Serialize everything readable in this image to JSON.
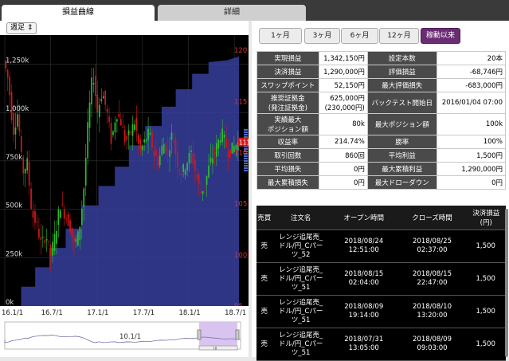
{
  "tabs": [
    "損益曲線",
    "詳細"
  ],
  "period_select": "週足",
  "periods": [
    "1ヶ月",
    "3ヶ月",
    "6ヶ月",
    "12ヶ月",
    "稼動以来"
  ],
  "stats": [
    [
      "実現損益",
      "1,342,150円",
      "g",
      "設定本数",
      "20本",
      ""
    ],
    [
      "決済損益",
      "1,290,000円",
      "g",
      "評価損益",
      "-68,746円",
      "r"
    ],
    [
      "スワップポイント",
      "52,150円",
      "g",
      "最大評価損失",
      "-683,000円",
      "r"
    ],
    [
      "推奨証拠金\n(発注証拠金)",
      "625,000円\n(230,000円)",
      "",
      "バックテスト開始日",
      "2016/01/04 07:00",
      ""
    ],
    [
      "実績最大\nポジション額",
      "80k",
      "",
      "最大ポジション額",
      "100k",
      ""
    ],
    [
      "収益率",
      "214.74%",
      "g",
      "勝率",
      "100%",
      ""
    ],
    [
      "取引回数",
      "860回",
      "",
      "平均利益",
      "1,500円",
      "g"
    ],
    [
      "平均損失",
      "0円",
      "",
      "最大累積利益",
      "1,290,000円",
      "g"
    ],
    [
      "最大累積損失",
      "0円",
      "",
      "最大ドローダウン",
      "0円",
      ""
    ]
  ],
  "trade_headers": [
    "売買",
    "注文名",
    "オープン時間",
    "クローズ時間",
    "決済損益\n(円)"
  ],
  "trades": [
    [
      "売",
      "レンジ追尾売_\nドル/円_Cパー\nツ_52",
      "2018/08/24\n12:51:00",
      "2018/08/25\n02:37:00",
      "1,500"
    ],
    [
      "売",
      "レンジ追尾売_\nドル/円_Cパー\nツ_51",
      "2018/08/15\n02:04:00",
      "2018/08/15\n22:47:00",
      "1,500"
    ],
    [
      "売",
      "レンジ追尾売_\nドル/円_Cパー\nツ_51",
      "2018/08/09\n19:14:00",
      "2018/08/10\n13:20:00",
      "1,500"
    ],
    [
      "売",
      "レンジ追尾売_\nドル/円_Cパー\nツ_51",
      "2018/07/31\n13:05:00",
      "2018/08/09\n09:03:00",
      "1,500"
    ]
  ],
  "chart_data": {
    "type": "area",
    "x_ticks": [
      "16.1/1",
      "16.7/1",
      "17.1/1",
      "17.7/1",
      "18.1/1",
      "18.7/1"
    ],
    "y_left_ticks": [
      "0k",
      "250k",
      "500k",
      "750k",
      "1,000k",
      "1,250k"
    ],
    "y_left_lim": [
      0,
      1400000
    ],
    "y_right_ticks": [
      "95",
      "100",
      "105",
      "110",
      "115",
      "120"
    ],
    "y_right_lim": [
      95,
      121.5
    ],
    "profit_curve": [
      [
        0,
        0
      ],
      [
        0.07,
        0
      ],
      [
        0.07,
        100000
      ],
      [
        0.13,
        100000
      ],
      [
        0.13,
        200000
      ],
      [
        0.19,
        200000
      ],
      [
        0.19,
        300000
      ],
      [
        0.26,
        300000
      ],
      [
        0.26,
        400000
      ],
      [
        0.33,
        400000
      ],
      [
        0.33,
        520000
      ],
      [
        0.4,
        520000
      ],
      [
        0.4,
        620000
      ],
      [
        0.47,
        620000
      ],
      [
        0.47,
        720000
      ],
      [
        0.53,
        720000
      ],
      [
        0.53,
        830000
      ],
      [
        0.6,
        830000
      ],
      [
        0.6,
        930000
      ],
      [
        0.67,
        930000
      ],
      [
        0.67,
        1030000
      ],
      [
        0.73,
        1030000
      ],
      [
        0.73,
        1120000
      ],
      [
        0.8,
        1120000
      ],
      [
        0.8,
        1200000
      ],
      [
        0.87,
        1200000
      ],
      [
        0.87,
        1260000
      ],
      [
        0.95,
        1270000
      ],
      [
        1,
        1290000
      ]
    ],
    "price_path": [
      [
        0,
        119
      ],
      [
        0.02,
        117
      ],
      [
        0.04,
        112
      ],
      [
        0.06,
        114
      ],
      [
        0.08,
        108
      ],
      [
        0.1,
        109
      ],
      [
        0.12,
        104
      ],
      [
        0.14,
        103
      ],
      [
        0.16,
        101
      ],
      [
        0.18,
        102
      ],
      [
        0.2,
        100
      ],
      [
        0.22,
        102
      ],
      [
        0.24,
        105
      ],
      [
        0.26,
        104
      ],
      [
        0.28,
        103
      ],
      [
        0.3,
        101
      ],
      [
        0.32,
        102
      ],
      [
        0.34,
        106
      ],
      [
        0.36,
        113
      ],
      [
        0.38,
        118
      ],
      [
        0.4,
        114
      ],
      [
        0.42,
        116
      ],
      [
        0.44,
        114
      ],
      [
        0.46,
        111
      ],
      [
        0.48,
        114
      ],
      [
        0.5,
        113
      ],
      [
        0.52,
        111
      ],
      [
        0.54,
        112
      ],
      [
        0.56,
        113
      ],
      [
        0.58,
        110
      ],
      [
        0.6,
        111
      ],
      [
        0.62,
        112
      ],
      [
        0.64,
        110
      ],
      [
        0.66,
        109
      ],
      [
        0.68,
        111
      ],
      [
        0.7,
        110
      ],
      [
        0.72,
        112
      ],
      [
        0.74,
        109
      ],
      [
        0.76,
        108
      ],
      [
        0.8,
        110
      ],
      [
        0.82,
        108
      ],
      [
        0.84,
        106
      ],
      [
        0.86,
        107
      ],
      [
        0.88,
        109
      ],
      [
        0.9,
        110
      ],
      [
        0.93,
        112
      ],
      [
        0.96,
        110
      ],
      [
        1,
        111
      ]
    ],
    "last_price_label": "111.",
    "navigator_label": "10.1/1",
    "navigator_handle": "III"
  },
  "colors": {
    "tab_bar": "#3a3a3a",
    "profit_area": "#363e9c",
    "candle_up": "#2ebc2e",
    "candle_down": "#d21818",
    "active_period": "#6b2c75",
    "gain": "#2c9c2c",
    "loss": "#e01010"
  }
}
